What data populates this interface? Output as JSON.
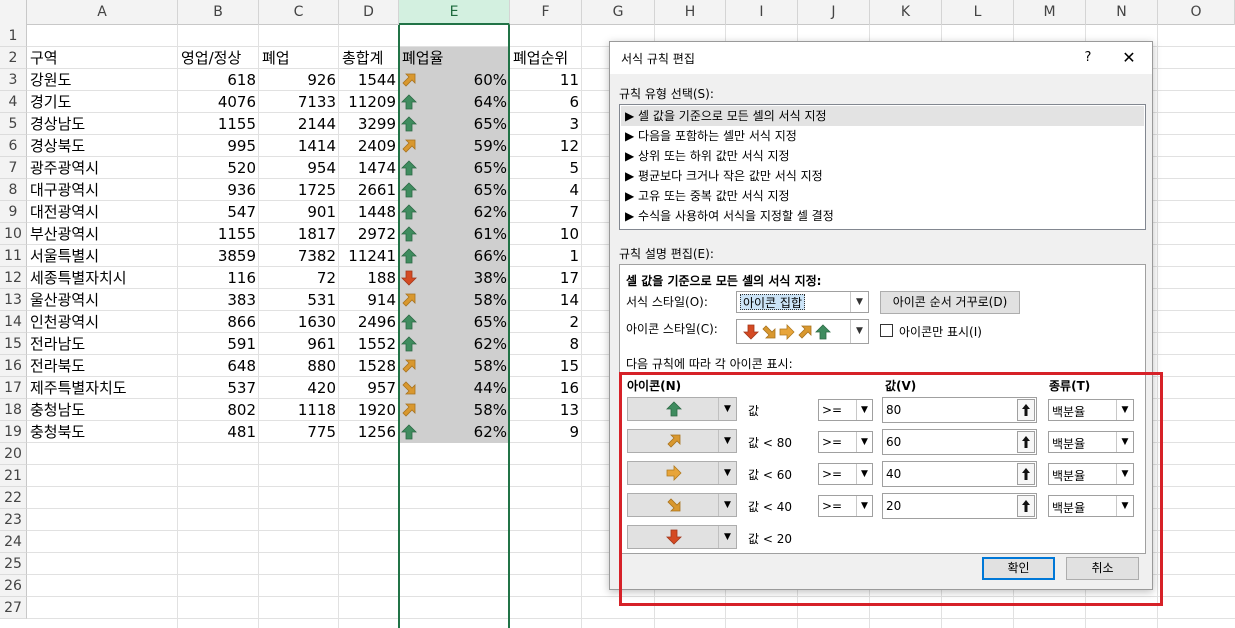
{
  "sheet": {
    "columns": [
      "A",
      "B",
      "C",
      "D",
      "E",
      "F",
      "G",
      "H",
      "I",
      "J",
      "K",
      "L",
      "M",
      "N",
      "O"
    ],
    "rows": [
      "1",
      "2",
      "3",
      "4",
      "5",
      "6",
      "7",
      "8",
      "9",
      "10",
      "11",
      "12",
      "13",
      "14",
      "15",
      "16",
      "17",
      "18",
      "19",
      "20",
      "21",
      "22",
      "23",
      "24",
      "25",
      "26",
      "27"
    ],
    "header": [
      "구역",
      "영업/정상",
      "폐업",
      "총합계",
      "폐업율",
      "폐업순위"
    ],
    "data": [
      {
        "region": "강원도",
        "open": "618",
        "closed": "926",
        "total": "1544",
        "rate": "60%",
        "rank": "11",
        "icon": "ne"
      },
      {
        "region": "경기도",
        "open": "4076",
        "closed": "7133",
        "total": "11209",
        "rate": "64%",
        "rank": "6",
        "icon": "up"
      },
      {
        "region": "경상남도",
        "open": "1155",
        "closed": "2144",
        "total": "3299",
        "rate": "65%",
        "rank": "3",
        "icon": "up"
      },
      {
        "region": "경상북도",
        "open": "995",
        "closed": "1414",
        "total": "2409",
        "rate": "59%",
        "rank": "12",
        "icon": "ne"
      },
      {
        "region": "광주광역시",
        "open": "520",
        "closed": "954",
        "total": "1474",
        "rate": "65%",
        "rank": "5",
        "icon": "up"
      },
      {
        "region": "대구광역시",
        "open": "936",
        "closed": "1725",
        "total": "2661",
        "rate": "65%",
        "rank": "4",
        "icon": "up"
      },
      {
        "region": "대전광역시",
        "open": "547",
        "closed": "901",
        "total": "1448",
        "rate": "62%",
        "rank": "7",
        "icon": "up"
      },
      {
        "region": "부산광역시",
        "open": "1155",
        "closed": "1817",
        "total": "2972",
        "rate": "61%",
        "rank": "10",
        "icon": "up"
      },
      {
        "region": "서울특별시",
        "open": "3859",
        "closed": "7382",
        "total": "11241",
        "rate": "66%",
        "rank": "1",
        "icon": "up"
      },
      {
        "region": "세종특별자치시",
        "open": "116",
        "closed": "72",
        "total": "188",
        "rate": "38%",
        "rank": "17",
        "icon": "down"
      },
      {
        "region": "울산광역시",
        "open": "383",
        "closed": "531",
        "total": "914",
        "rate": "58%",
        "rank": "14",
        "icon": "ne"
      },
      {
        "region": "인천광역시",
        "open": "866",
        "closed": "1630",
        "total": "2496",
        "rate": "65%",
        "rank": "2",
        "icon": "up"
      },
      {
        "region": "전라남도",
        "open": "591",
        "closed": "961",
        "total": "1552",
        "rate": "62%",
        "rank": "8",
        "icon": "up"
      },
      {
        "region": "전라북도",
        "open": "648",
        "closed": "880",
        "total": "1528",
        "rate": "58%",
        "rank": "15",
        "icon": "ne"
      },
      {
        "region": "제주특별자치도",
        "open": "537",
        "closed": "420",
        "total": "957",
        "rate": "44%",
        "rank": "16",
        "icon": "se"
      },
      {
        "region": "충청남도",
        "open": "802",
        "closed": "1118",
        "total": "1920",
        "rate": "58%",
        "rank": "13",
        "icon": "ne"
      },
      {
        "region": "충청북도",
        "open": "481",
        "closed": "775",
        "total": "1256",
        "rate": "62%",
        "rank": "9",
        "icon": "up"
      }
    ]
  },
  "dialog": {
    "title": "서식 규칙 편집",
    "help": "?",
    "close": "✕",
    "rule_type_label": "규칙 유형 선택(S):",
    "rule_types": [
      "▶ 셀 값을 기준으로 모든 셀의 서식 지정",
      "▶ 다음을 포함하는 셀만 서식 지정",
      "▶ 상위 또는 하위 값만 서식 지정",
      "▶ 평균보다 크거나 작은 값만 서식 지정",
      "▶ 고유 또는 중복 값만 서식 지정",
      "▶ 수식을 사용하여 서식을 지정할 셀 결정"
    ],
    "rule_desc_label": "규칙 설명 편집(E):",
    "panel_heading": "셀 값을 기준으로 모든 셀의 서식 지정:",
    "format_style_label": "서식 스타일(O):",
    "format_style_value": "아이콘 집합",
    "reverse_order_button": "아이콘 순서 거꾸로(D)",
    "icon_style_label": "아이콘 스타일(C):",
    "icon_only_label": "아이콘만 표시(I)",
    "display_rule_label": "다음 규칙에 따라 각 아이콘 표시:",
    "col_icon": "아이콘(N)",
    "col_value": "값(V)",
    "col_type": "종류(T)",
    "rules": [
      {
        "icon": "up",
        "cond": "값",
        "op": ">=",
        "value": "80",
        "type": "백분율"
      },
      {
        "icon": "ne",
        "cond": "값 < 80",
        "op": ">=",
        "value": "60",
        "type": "백분율"
      },
      {
        "icon": "right",
        "cond": "값 < 60",
        "op": ">=",
        "value": "40",
        "type": "백분율"
      },
      {
        "icon": "se",
        "cond": "값 < 40",
        "op": ">=",
        "value": "20",
        "type": "백분율"
      },
      {
        "icon": "down",
        "cond": "값 < 20",
        "op": "",
        "value": "",
        "type": ""
      }
    ],
    "ok_button": "확인",
    "cancel_button": "취소"
  },
  "colors": {
    "green": "#3f8c5f",
    "lightgreen": "#7fb27c",
    "yellow": "#e8a53a",
    "orange": "#d9982f",
    "red": "#d44a23",
    "highlight": "#d62128",
    "selection": "#217346"
  }
}
